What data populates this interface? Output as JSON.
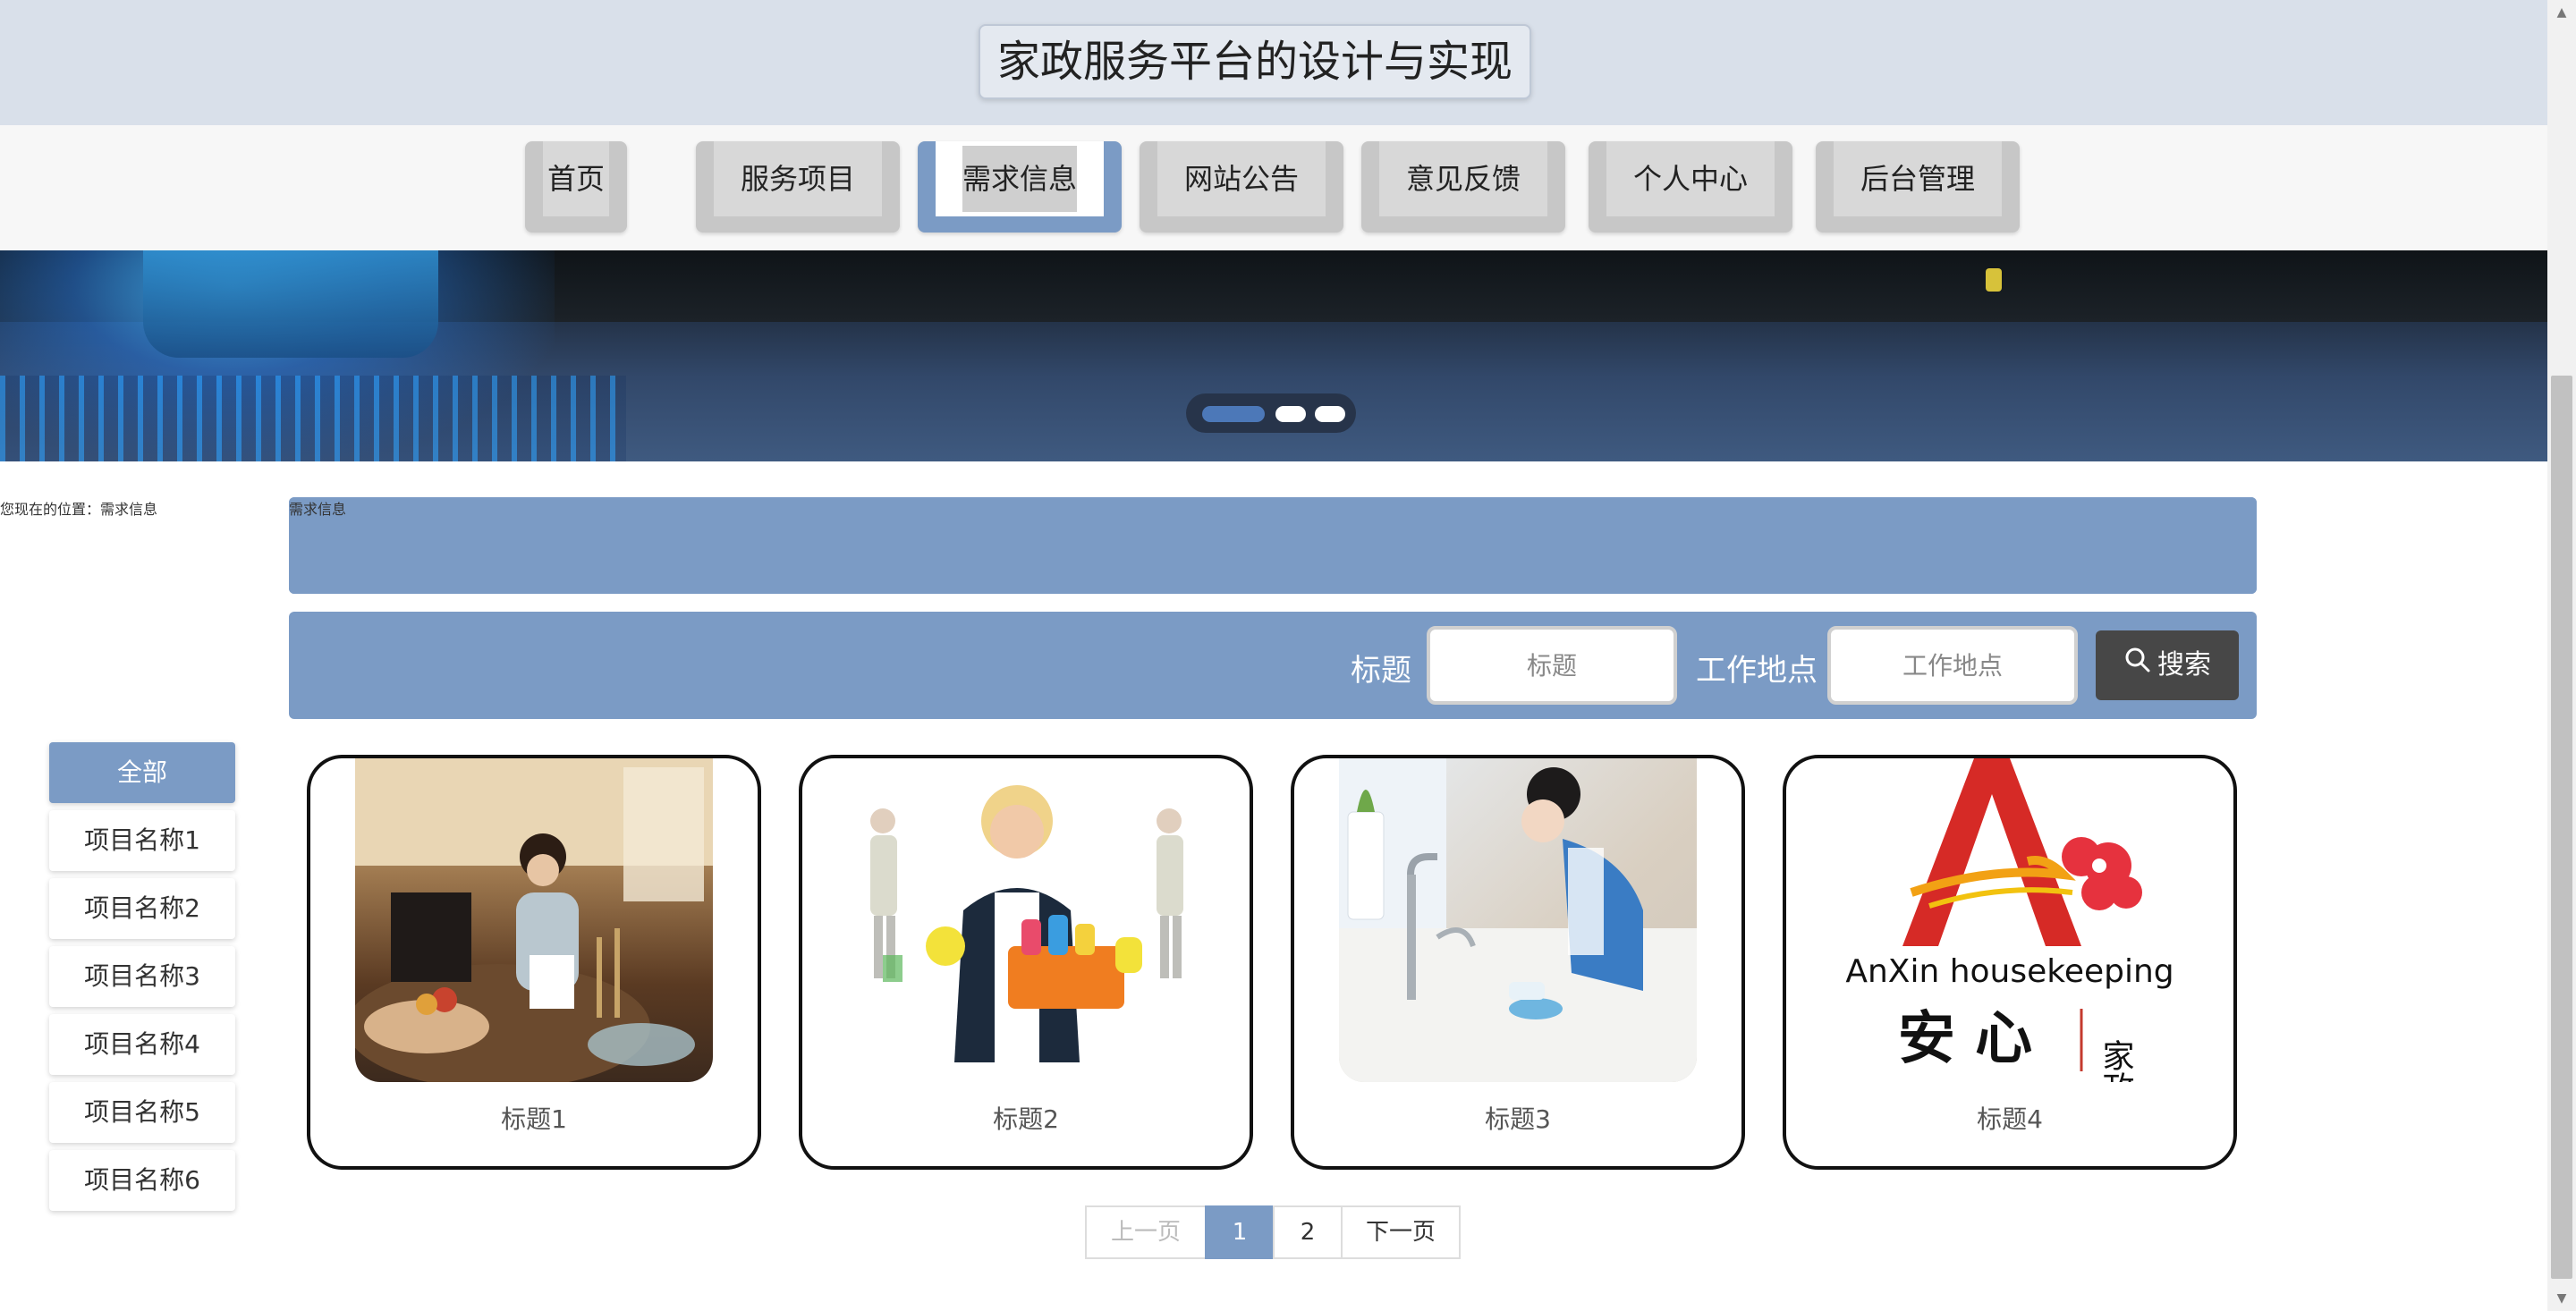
{
  "header": {
    "site_title": "家政服务平台的设计与实现"
  },
  "nav": {
    "items": [
      {
        "label": "首页"
      },
      {
        "label": "服务项目"
      },
      {
        "label": "需求信息"
      },
      {
        "label": "网站公告"
      },
      {
        "label": "意见反馈"
      },
      {
        "label": "个人中心"
      },
      {
        "label": "后台管理"
      }
    ],
    "active_index": 2
  },
  "banner": {
    "slide_count": 3,
    "active_slide": 1
  },
  "breadcrumb": {
    "title": "需求信息",
    "location": "您现在的位置：需求信息"
  },
  "search": {
    "title_label": "标题",
    "title_placeholder": "标题",
    "location_label": "工作地点",
    "location_placeholder": "工作地点",
    "button_label": "搜索"
  },
  "categories": {
    "items": [
      {
        "label": "全部"
      },
      {
        "label": "项目名称1"
      },
      {
        "label": "项目名称2"
      },
      {
        "label": "项目名称3"
      },
      {
        "label": "项目名称4"
      },
      {
        "label": "项目名称5"
      },
      {
        "label": "项目名称6"
      }
    ],
    "active_index": 0
  },
  "cards": [
    {
      "caption": "标题1"
    },
    {
      "caption": "标题2"
    },
    {
      "caption": "标题3"
    },
    {
      "caption": "标题4",
      "logo_text": "AnXin housekeeping",
      "logo_cn_main": "安 心",
      "logo_cn_side": "家政"
    }
  ],
  "pagination": {
    "prev": "上一页",
    "pages": [
      "1",
      "2"
    ],
    "current": "1",
    "next": "下一页"
  },
  "colors": {
    "accent": "#7b9bc5",
    "header_bg": "#d9e0ea",
    "search_button": "#474747"
  }
}
